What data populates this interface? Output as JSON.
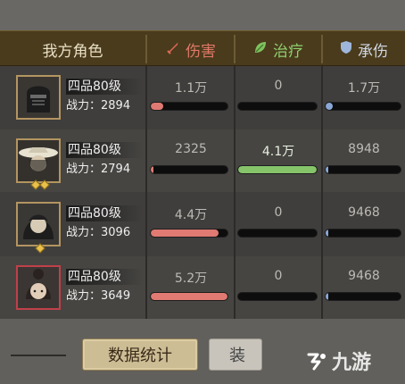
{
  "header": {
    "title": "我方角色",
    "damage_label": "伤害",
    "heal_label": "治疗",
    "tank_label": "承伤",
    "damage_icon": "sword-icon",
    "heal_icon": "leaf-icon",
    "tank_icon": "shield-icon"
  },
  "rows": [
    {
      "rank": "四品80级",
      "power": "战力：2894",
      "damage": "1.1万",
      "heal": "0",
      "tank": "1.7万",
      "damage_pct": 0.16,
      "heal_pct": 0.0,
      "tank_pct": 0.1,
      "portrait": "helmet-knight-portrait"
    },
    {
      "rank": "四品80级",
      "power": "战力：2794",
      "damage": "2325",
      "heal": "4.1万",
      "tank": "8948",
      "damage_pct": 0.02,
      "heal_pct": 1.0,
      "tank_pct": 0.03,
      "portrait": "straw-hat-portrait"
    },
    {
      "rank": "四品80级",
      "power": "战力：3096",
      "damage": "4.4万",
      "heal": "0",
      "tank": "9468",
      "damage_pct": 0.88,
      "heal_pct": 0.0,
      "tank_pct": 0.03,
      "portrait": "dark-hair-portrait"
    },
    {
      "rank": "四品80级",
      "power": "战力：3649",
      "damage": "5.2万",
      "heal": "0",
      "tank": "9468",
      "damage_pct": 1.0,
      "heal_pct": 0.0,
      "tank_pct": 0.03,
      "portrait": "bun-girl-portrait"
    }
  ],
  "footer": {
    "stats_button": "数据统计",
    "second_button": "装",
    "watermark": "九游"
  },
  "colors": {
    "damage": "#e07a72",
    "heal": "#86c46a",
    "tank": "#8aa7d6",
    "header_bg": "#4a3b1c"
  }
}
